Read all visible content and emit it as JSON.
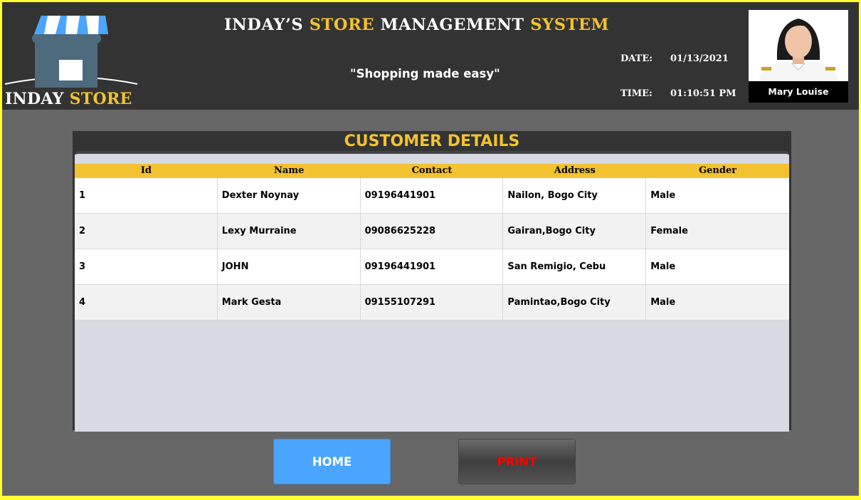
{
  "header": {
    "logo_word1": "INDAY",
    "logo_word2": "STORE",
    "title_part1": "INDAY’S",
    "title_part2": "STORE",
    "title_part3": "MANAGEMENT",
    "title_part4": "SYSTEM",
    "tagline": "\"Shopping made easy\"",
    "date_label": "DATE:",
    "date_value": "01/13/2021",
    "time_label": "TIME:",
    "time_value": "01:10:51 PM",
    "user_name": "Mary Louise"
  },
  "customers": {
    "title": "CUSTOMER DETAILS",
    "columns": [
      "Id",
      "Name",
      "Contact",
      "Address",
      "Gender"
    ],
    "rows": [
      [
        "1",
        "Dexter Noynay",
        "09196441901",
        "Nailon, Bogo City",
        "Male"
      ],
      [
        "2",
        "Lexy Murraine",
        "09086625228",
        "Gairan,Bogo City",
        "Female"
      ],
      [
        "3",
        "JOHN",
        "09196441901",
        "San Remigio, Cebu",
        "Male"
      ],
      [
        "4",
        "Mark Gesta",
        "09155107291",
        "Pamintao,Bogo City",
        "Male"
      ]
    ]
  },
  "buttons": {
    "home_label": "HOME",
    "print_label": "PRINT"
  },
  "colors": {
    "accent_yellow": "#f2c230",
    "header_bg": "#333333",
    "page_bg": "#666666",
    "home_button": "#4aa5ff",
    "print_text": "#ff0000"
  },
  "icons": {
    "logo": "store-awning-icon",
    "avatar": "user-photo"
  }
}
